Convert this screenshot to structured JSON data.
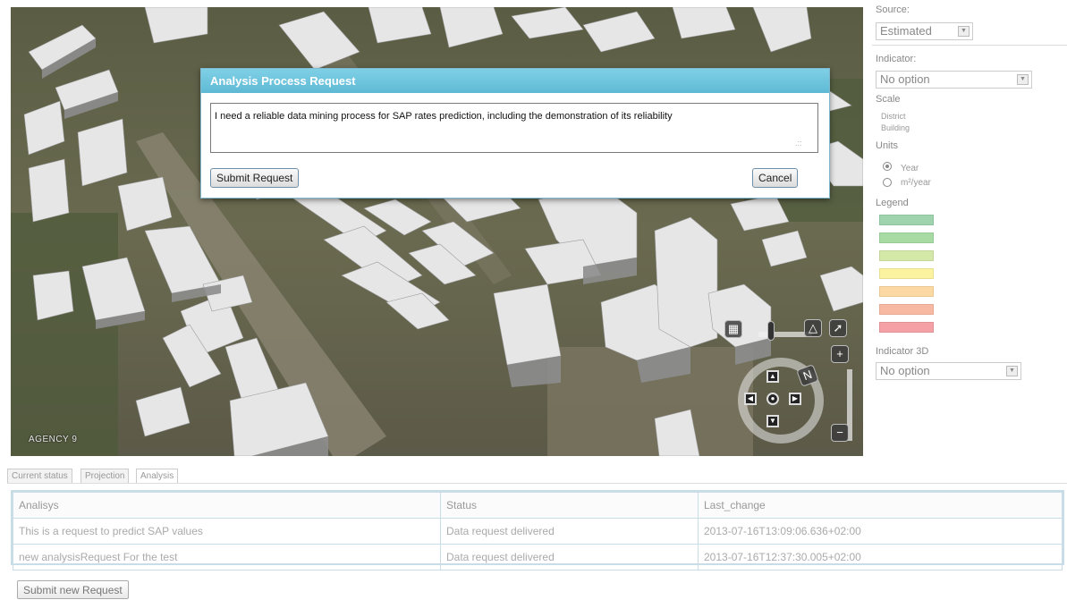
{
  "map": {
    "attribution": "AGENCY 9"
  },
  "modal": {
    "title": "Analysis Process Request",
    "request_text": "I need a reliable data mining process for SAP rates prediction, including the demonstration of its reliability",
    "submit_label": "Submit Request",
    "cancel_label": "Cancel"
  },
  "panel": {
    "source_label": "Source:",
    "source_value": "Estimated",
    "indicator_label": "Indicator:",
    "indicator_value": "No option",
    "scale_label": "Scale",
    "scale_options": [
      "District",
      "Building"
    ],
    "units_label": "Units",
    "units_options": [
      {
        "label": "Year",
        "checked": true
      },
      {
        "label": "m²/year",
        "checked": false
      }
    ],
    "legend_label": "Legend",
    "legend_colors": [
      "#9ed3ad",
      "#a7dba3",
      "#d4e8a8",
      "#fbf3a0",
      "#fcd9a2",
      "#f8b9a2",
      "#f4a0a4"
    ],
    "indicator3d_label": "Indicator 3D",
    "indicator3d_value": "No option"
  },
  "tabs": [
    "Current status",
    "Projection",
    "Analysis"
  ],
  "active_tab": "Analysis",
  "table": {
    "headers": [
      "Analisys",
      "Status",
      "Last_change"
    ],
    "rows": [
      [
        "This is a request to predict SAP values",
        "Data request delivered",
        "2013-07-16T13:09:06.636+02:00"
      ],
      [
        "new analysisRequest For the test",
        "Data request delivered",
        "2013-07-16T12:37:30.005+02:00"
      ]
    ]
  },
  "bottom": {
    "new_request_label": "Submit new Request"
  }
}
